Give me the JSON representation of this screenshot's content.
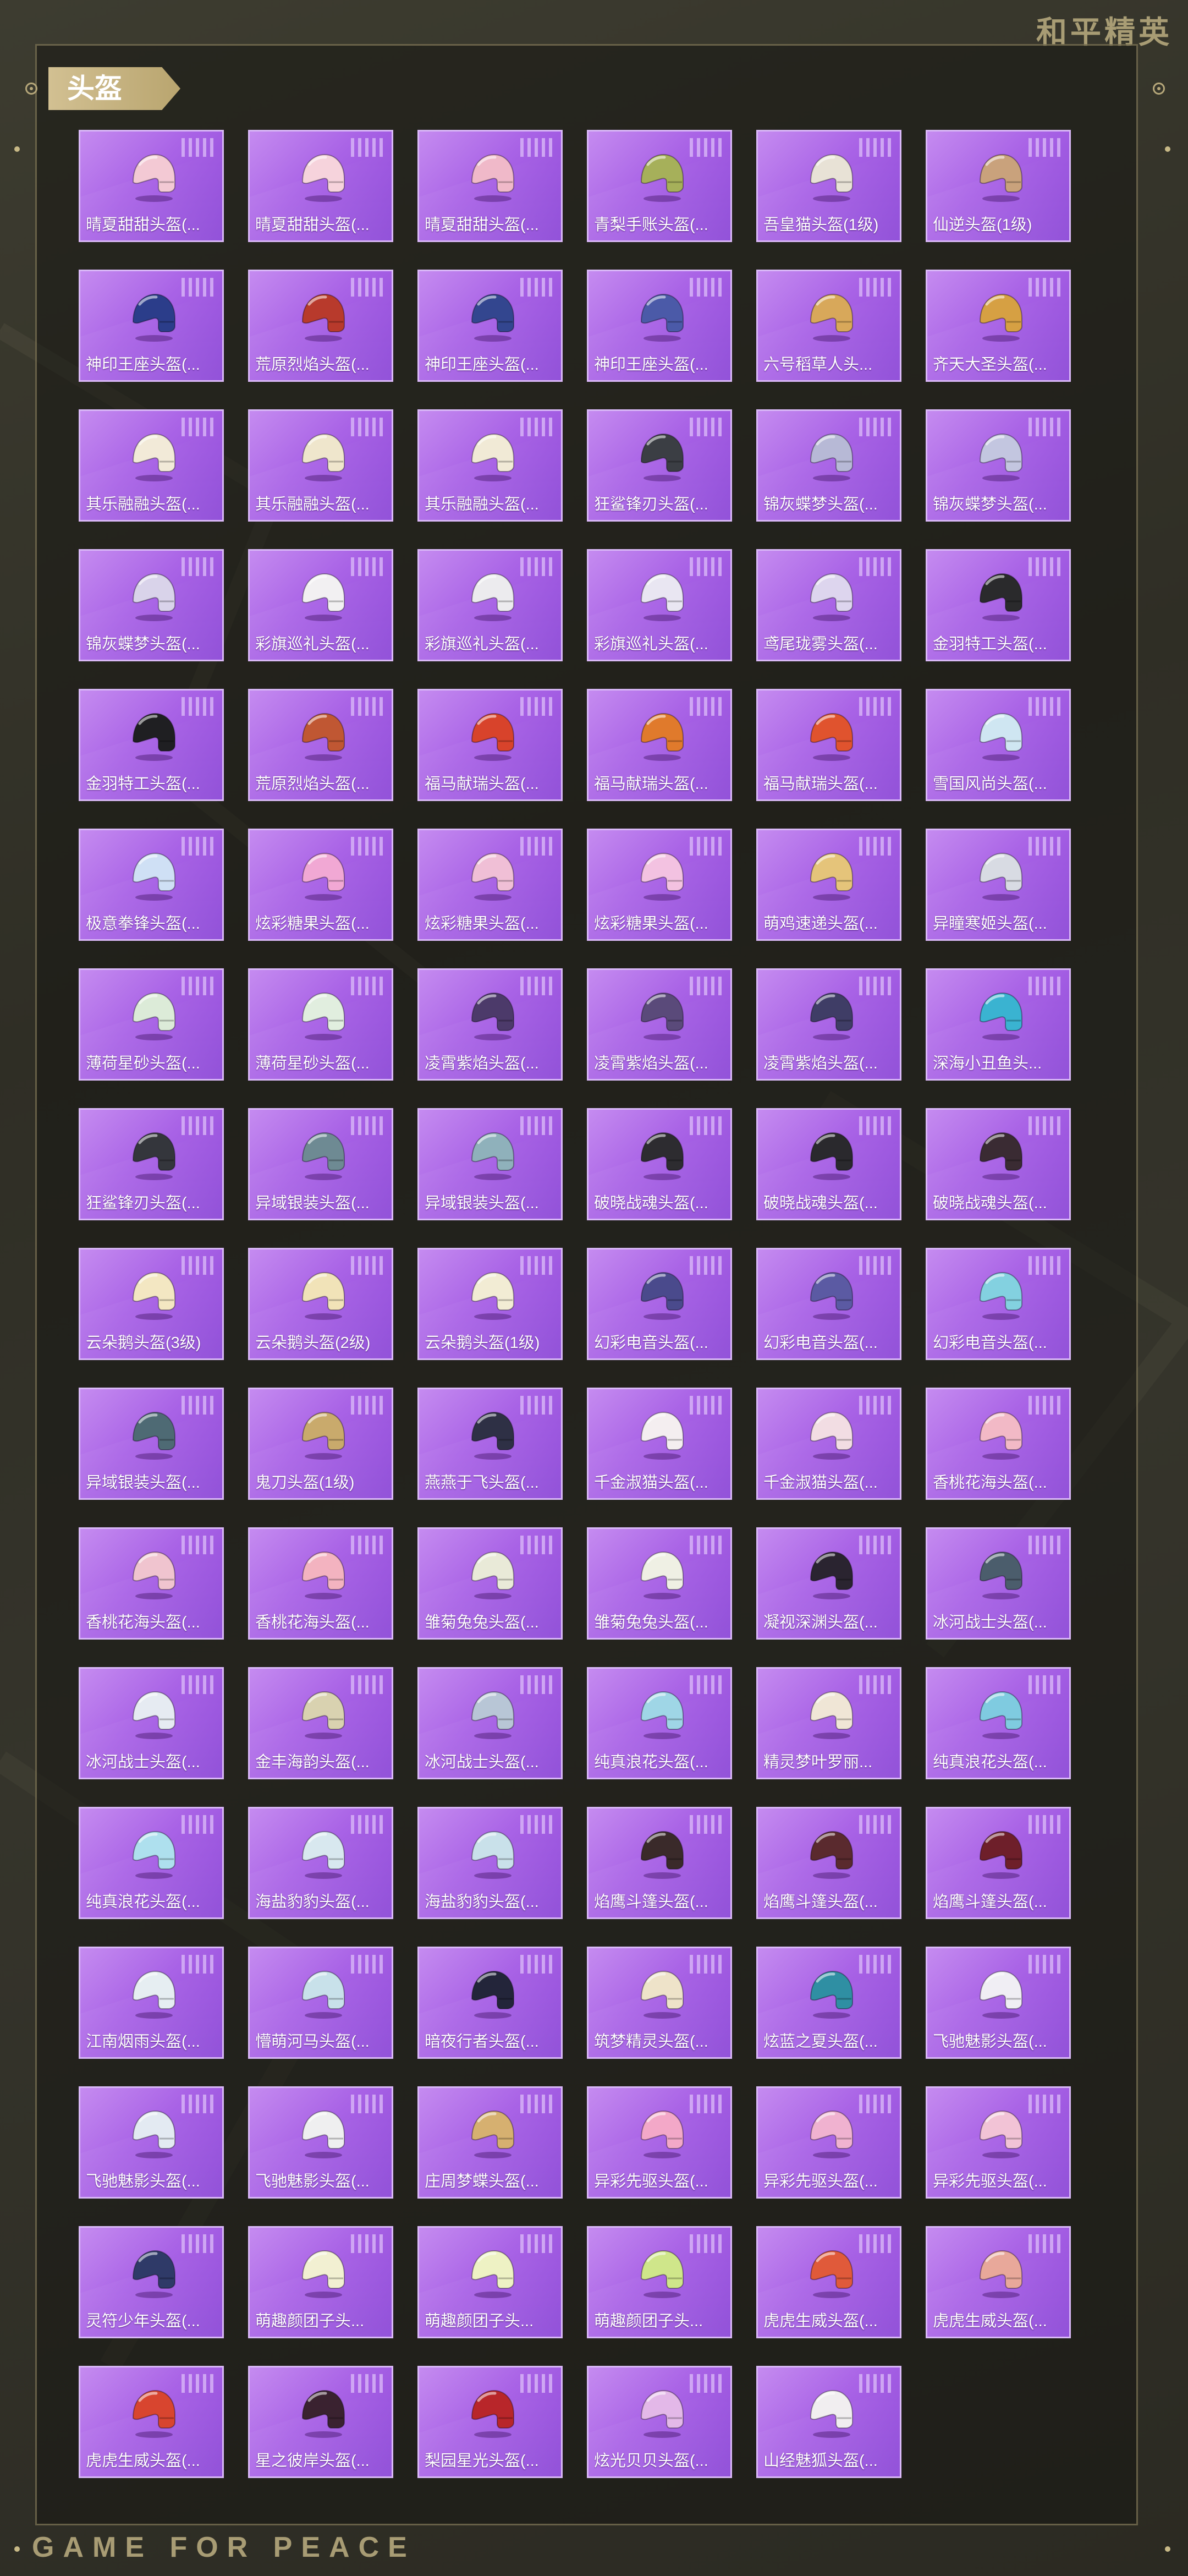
{
  "brand": "和平精英",
  "footer": "GAME FOR PEACE",
  "section_title": "头盔",
  "items": [
    {
      "label": "晴夏甜甜头盔(...",
      "color": "#f3c9d4",
      "icon": "helmet-icon"
    },
    {
      "label": "晴夏甜甜头盔(...",
      "color": "#f6d3dc",
      "icon": "helmet-icon"
    },
    {
      "label": "晴夏甜甜头盔(...",
      "color": "#f0b9c9",
      "icon": "helmet-icon"
    },
    {
      "label": "青梨手账头盔(...",
      "color": "#a6b05a",
      "icon": "helmet-icon"
    },
    {
      "label": "吾皇猫头盔(1级)",
      "color": "#e8e2d6",
      "icon": "helmet-icon"
    },
    {
      "label": "仙逆头盔(1级)",
      "color": "#c9a27c",
      "icon": "helmet-icon"
    },
    {
      "label": "神印王座头盔(...",
      "color": "#2b3d8a",
      "icon": "helmet-icon"
    },
    {
      "label": "荒原烈焰头盔(...",
      "color": "#b83a2c",
      "icon": "helmet-icon"
    },
    {
      "label": "神印王座头盔(...",
      "color": "#33468f",
      "icon": "helmet-icon"
    },
    {
      "label": "神印王座头盔(...",
      "color": "#4b5aa8",
      "icon": "helmet-icon"
    },
    {
      "label": "六号稻草人头...",
      "color": "#d8a85a",
      "icon": "helmet-icon"
    },
    {
      "label": "齐天大圣头盔(...",
      "color": "#d6a043",
      "icon": "helmet-icon"
    },
    {
      "label": "其乐融融头盔(...",
      "color": "#f2ead8",
      "icon": "helmet-icon"
    },
    {
      "label": "其乐融融头盔(...",
      "color": "#efe6cc",
      "icon": "helmet-icon"
    },
    {
      "label": "其乐融融头盔(...",
      "color": "#f1ead6",
      "icon": "helmet-icon"
    },
    {
      "label": "狂鲨锋刃头盔(...",
      "color": "#3b3e44",
      "icon": "helmet-icon"
    },
    {
      "label": "锦灰蝶梦头盔(...",
      "color": "#b7b9d6",
      "icon": "helmet-icon"
    },
    {
      "label": "锦灰蝶梦头盔(...",
      "color": "#c3c6e0",
      "icon": "helmet-icon"
    },
    {
      "label": "锦灰蝶梦头盔(...",
      "color": "#d9d3ea",
      "icon": "helmet-icon"
    },
    {
      "label": "彩旗巡礼头盔(...",
      "color": "#f2f0f2",
      "icon": "helmet-icon"
    },
    {
      "label": "彩旗巡礼头盔(...",
      "color": "#ecebee",
      "icon": "helmet-icon"
    },
    {
      "label": "彩旗巡礼头盔(...",
      "color": "#e9e6f2",
      "icon": "helmet-icon"
    },
    {
      "label": "鸢尾珑雾头盔(...",
      "color": "#ddd5ee",
      "icon": "helmet-icon"
    },
    {
      "label": "金羽特工头盔(...",
      "color": "#2a2a2c",
      "icon": "helmet-icon"
    },
    {
      "label": "金羽特工头盔(...",
      "color": "#1f1f22",
      "icon": "helmet-icon"
    },
    {
      "label": "荒原烈焰头盔(...",
      "color": "#c05733",
      "icon": "helmet-icon"
    },
    {
      "label": "福马献瑞头盔(...",
      "color": "#d8432b",
      "icon": "helmet-icon"
    },
    {
      "label": "福马献瑞头盔(...",
      "color": "#e07a2c",
      "icon": "helmet-icon"
    },
    {
      "label": "福马献瑞头盔(...",
      "color": "#e0532e",
      "icon": "helmet-icon"
    },
    {
      "label": "雪国风尚头盔(...",
      "color": "#cfe6f2",
      "icon": "helmet-icon"
    },
    {
      "label": "极意拳锋头盔(...",
      "color": "#cfe0f5",
      "icon": "helmet-icon"
    },
    {
      "label": "炫彩糖果头盔(...",
      "color": "#f1a8d4",
      "icon": "helmet-icon"
    },
    {
      "label": "炫彩糖果头盔(...",
      "color": "#f0bfd6",
      "icon": "helmet-icon"
    },
    {
      "label": "炫彩糖果头盔(...",
      "color": "#f3c2e1",
      "icon": "helmet-icon"
    },
    {
      "label": "萌鸡速递头盔(...",
      "color": "#e5c47a",
      "icon": "helmet-icon"
    },
    {
      "label": "异瞳寒姬头盔(...",
      "color": "#d8dbe3",
      "icon": "helmet-icon"
    },
    {
      "label": "薄荷星砂头盔(...",
      "color": "#dcebd8",
      "icon": "helmet-icon"
    },
    {
      "label": "薄荷星砂头盔(...",
      "color": "#e1eedf",
      "icon": "helmet-icon"
    },
    {
      "label": "凌霄紫焰头盔(...",
      "color": "#4c3a6a",
      "icon": "helmet-icon"
    },
    {
      "label": "凌霄紫焰头盔(...",
      "color": "#5a4a7a",
      "icon": "helmet-icon"
    },
    {
      "label": "凌霄紫焰头盔(...",
      "color": "#3f3d66",
      "icon": "helmet-icon"
    },
    {
      "label": "深海小丑鱼头...",
      "color": "#3ab3d1",
      "icon": "helmet-icon"
    },
    {
      "label": "狂鲨锋刃头盔(...",
      "color": "#34363c",
      "icon": "helmet-icon"
    },
    {
      "label": "异域银装头盔(...",
      "color": "#6e8a93",
      "icon": "helmet-icon"
    },
    {
      "label": "异域银装头盔(...",
      "color": "#8fb1bb",
      "icon": "helmet-icon"
    },
    {
      "label": "破晓战魂头盔(...",
      "color": "#2d2c30",
      "icon": "helmet-icon"
    },
    {
      "label": "破晓战魂头盔(...",
      "color": "#2a292d",
      "icon": "helmet-icon"
    },
    {
      "label": "破晓战魂头盔(...",
      "color": "#3a2b33",
      "icon": "helmet-icon"
    },
    {
      "label": "云朵鹅头盔(3级)",
      "color": "#f3e7c2",
      "icon": "helmet-icon"
    },
    {
      "label": "云朵鹅头盔(2级)",
      "color": "#f1e3b8",
      "icon": "helmet-icon"
    },
    {
      "label": "云朵鹅头盔(1级)",
      "color": "#f2ecd4",
      "icon": "helmet-icon"
    },
    {
      "label": "幻彩电音头盔(...",
      "color": "#4a4a8c",
      "icon": "helmet-icon"
    },
    {
      "label": "幻彩电音头盔(...",
      "color": "#5b5aa3",
      "icon": "helmet-icon"
    },
    {
      "label": "幻彩电音头盔(...",
      "color": "#83d1e0",
      "icon": "helmet-icon"
    },
    {
      "label": "异域银装头盔(...",
      "color": "#4e6a74",
      "icon": "helmet-icon"
    },
    {
      "label": "鬼刀头盔(1级)",
      "color": "#c9aa6c",
      "icon": "helmet-icon"
    },
    {
      "label": "燕燕于飞头盔(...",
      "color": "#2e3045",
      "icon": "helmet-icon"
    },
    {
      "label": "千金淑猫头盔(...",
      "color": "#f4eef0",
      "icon": "helmet-icon"
    },
    {
      "label": "千金淑猫头盔(...",
      "color": "#f2dde3",
      "icon": "helmet-icon"
    },
    {
      "label": "香桃花海头盔(...",
      "color": "#f2b9c6",
      "icon": "helmet-icon"
    },
    {
      "label": "香桃花海头盔(...",
      "color": "#f0c4cf",
      "icon": "helmet-icon"
    },
    {
      "label": "香桃花海头盔(...",
      "color": "#f3b3c0",
      "icon": "helmet-icon"
    },
    {
      "label": "雏菊兔兔头盔(...",
      "color": "#e9ead8",
      "icon": "helmet-icon"
    },
    {
      "label": "雏菊兔兔头盔(...",
      "color": "#eff0e4",
      "icon": "helmet-icon"
    },
    {
      "label": "凝视深渊头盔(...",
      "color": "#2a2430",
      "icon": "helmet-icon"
    },
    {
      "label": "冰河战士头盔(...",
      "color": "#4b5d6c",
      "icon": "helmet-icon"
    },
    {
      "label": "冰河战士头盔(...",
      "color": "#e6ebf2",
      "icon": "helmet-icon"
    },
    {
      "label": "金丰海韵头盔(...",
      "color": "#d9d2b0",
      "icon": "helmet-icon"
    },
    {
      "label": "冰河战士头盔(...",
      "color": "#b8c6d6",
      "icon": "helmet-icon"
    },
    {
      "label": "纯真浪花头盔(...",
      "color": "#9fd6e6",
      "icon": "helmet-icon"
    },
    {
      "label": "精灵梦叶罗丽...",
      "color": "#f0e6d6",
      "icon": "helmet-icon"
    },
    {
      "label": "纯真浪花头盔(...",
      "color": "#7fcbe0",
      "icon": "helmet-icon"
    },
    {
      "label": "纯真浪花头盔(...",
      "color": "#aee0ee",
      "icon": "helmet-icon"
    },
    {
      "label": "海盐豹豹头盔(...",
      "color": "#d8e8ef",
      "icon": "helmet-icon"
    },
    {
      "label": "海盐豹豹头盔(...",
      "color": "#c9e1ea",
      "icon": "helmet-icon"
    },
    {
      "label": "焰鹰斗篷头盔(...",
      "color": "#3a2a2a",
      "icon": "helmet-icon"
    },
    {
      "label": "焰鹰斗篷头盔(...",
      "color": "#5a2a2e",
      "icon": "helmet-icon"
    },
    {
      "label": "焰鹰斗篷头盔(...",
      "color": "#6e1f2a",
      "icon": "helmet-icon"
    },
    {
      "label": "江南烟雨头盔(...",
      "color": "#e6eef2",
      "icon": "helmet-icon"
    },
    {
      "label": "懵萌河马头盔(...",
      "color": "#c8e1ea",
      "icon": "helmet-icon"
    },
    {
      "label": "暗夜行者头盔(...",
      "color": "#23253a",
      "icon": "helmet-icon"
    },
    {
      "label": "筑梦精灵头盔(...",
      "color": "#eee3c9",
      "icon": "helmet-icon"
    },
    {
      "label": "炫蓝之夏头盔(...",
      "color": "#2f8fa3",
      "icon": "helmet-icon"
    },
    {
      "label": "飞驰魅影头盔(...",
      "color": "#f0eef4",
      "icon": "helmet-icon"
    },
    {
      "label": "飞驰魅影头盔(...",
      "color": "#e3eaf2",
      "icon": "helmet-icon"
    },
    {
      "label": "飞驰魅影头盔(...",
      "color": "#efeff0",
      "icon": "helmet-icon"
    },
    {
      "label": "庄周梦蝶头盔(...",
      "color": "#d6b070",
      "icon": "helmet-icon"
    },
    {
      "label": "异彩先驱头盔(...",
      "color": "#f3a8c8",
      "icon": "helmet-icon"
    },
    {
      "label": "异彩先驱头盔(...",
      "color": "#f0b2d0",
      "icon": "helmet-icon"
    },
    {
      "label": "异彩先驱头盔(...",
      "color": "#f2c3d6",
      "icon": "helmet-icon"
    },
    {
      "label": "灵符少年头盔(...",
      "color": "#2f3a68",
      "icon": "helmet-icon"
    },
    {
      "label": "萌趣颜团子头...",
      "color": "#f2f0d2",
      "icon": "helmet-icon"
    },
    {
      "label": "萌趣颜团子头...",
      "color": "#eef2c4",
      "icon": "helmet-icon"
    },
    {
      "label": "萌趣颜团子头...",
      "color": "#cfe68a",
      "icon": "helmet-icon"
    },
    {
      "label": "虎虎生威头盔(...",
      "color": "#e05a3a",
      "icon": "helmet-icon"
    },
    {
      "label": "虎虎生威头盔(...",
      "color": "#e8a89a",
      "icon": "helmet-icon"
    },
    {
      "label": "虎虎生威头盔(...",
      "color": "#d8452f",
      "icon": "helmet-icon"
    },
    {
      "label": "星之彼岸头盔(...",
      "color": "#3a2230",
      "icon": "helmet-icon"
    },
    {
      "label": "梨园星光头盔(...",
      "color": "#b8262a",
      "icon": "helmet-icon"
    },
    {
      "label": "炫光贝贝头盔(...",
      "color": "#e3b8e8",
      "icon": "helmet-icon"
    },
    {
      "label": "山经魅狐头盔(...",
      "color": "#f1eef0",
      "icon": "helmet-icon"
    }
  ]
}
